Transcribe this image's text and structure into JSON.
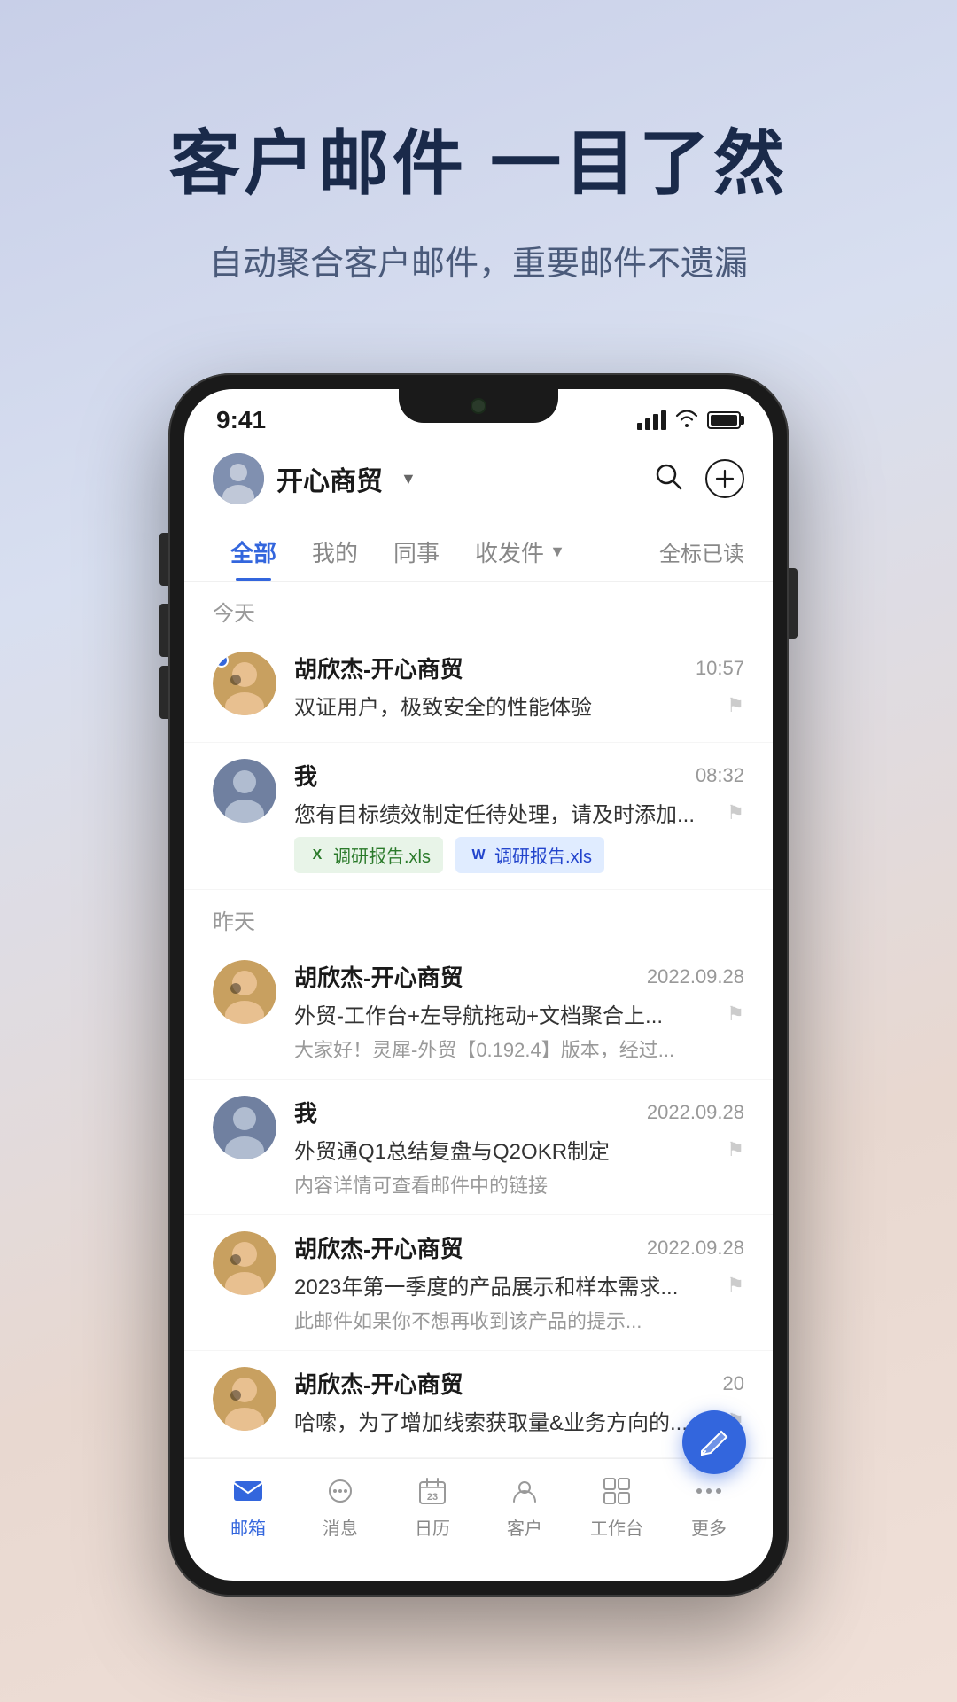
{
  "hero": {
    "title": "客户邮件 一目了然",
    "subtitle": "自动聚合客户邮件，重要邮件不遗漏"
  },
  "status_bar": {
    "time": "9:41"
  },
  "app_header": {
    "company_name": "开心商贸",
    "search_label": "搜索",
    "add_label": "新建"
  },
  "tabs": [
    {
      "label": "全部",
      "active": true
    },
    {
      "label": "我的",
      "active": false
    },
    {
      "label": "同事",
      "active": false
    },
    {
      "label": "收发件",
      "active": false,
      "has_arrow": true
    },
    {
      "label": "全标已读",
      "active": false,
      "align_right": true
    }
  ],
  "sections": [
    {
      "title": "今天",
      "emails": [
        {
          "sender": "胡欣杰-开心商贸",
          "time": "10:57",
          "subject": "双证用户，极致安全的性能体验",
          "preview": "",
          "unread": true,
          "avatar_type": "male1",
          "flag": true,
          "attachments": []
        },
        {
          "sender": "我",
          "time": "08:32",
          "subject": "您有目标绩效制定任待处理，请及时添加...",
          "preview": "",
          "unread": false,
          "avatar_type": "self",
          "flag": true,
          "attachments": [
            {
              "type": "xlsx",
              "name": "调研报告.xls"
            },
            {
              "type": "docx",
              "name": "调研报告.xls"
            }
          ]
        }
      ]
    },
    {
      "title": "昨天",
      "emails": [
        {
          "sender": "胡欣杰-开心商贸",
          "time": "2022.09.28",
          "subject": "外贸-工作台+左导航拖动+文档聚合上...",
          "preview": "大家好！灵犀-外贸【0.192.4】版本，经过...",
          "unread": false,
          "avatar_type": "male1",
          "flag": true,
          "attachments": []
        },
        {
          "sender": "我",
          "time": "2022.09.28",
          "subject": "外贸通Q1总结复盘与Q2OKR制定",
          "preview": "内容详情可查看邮件中的链接",
          "unread": false,
          "avatar_type": "self",
          "flag": true,
          "attachments": []
        },
        {
          "sender": "胡欣杰-开心商贸",
          "time": "2022.09.28",
          "subject": "2023年第一季度的产品展示和样本需求...",
          "preview": "此邮件如果你不想再收到该产品的提示...",
          "unread": false,
          "avatar_type": "male1",
          "flag": true,
          "attachments": []
        },
        {
          "sender": "胡欣杰-开心商贸",
          "time": "20",
          "subject": "哈嗦，为了增加线索获取量&业务方向的...",
          "preview": "",
          "unread": false,
          "avatar_type": "male1",
          "flag": true,
          "attachments": []
        }
      ]
    }
  ],
  "bottom_nav": [
    {
      "label": "邮箱",
      "active": true,
      "icon": "mail"
    },
    {
      "label": "消息",
      "active": false,
      "icon": "message"
    },
    {
      "label": "日历",
      "active": false,
      "icon": "calendar"
    },
    {
      "label": "客户",
      "active": false,
      "icon": "customer"
    },
    {
      "label": "工作台",
      "active": false,
      "icon": "workbench"
    },
    {
      "label": "更多",
      "active": false,
      "icon": "more"
    }
  ]
}
